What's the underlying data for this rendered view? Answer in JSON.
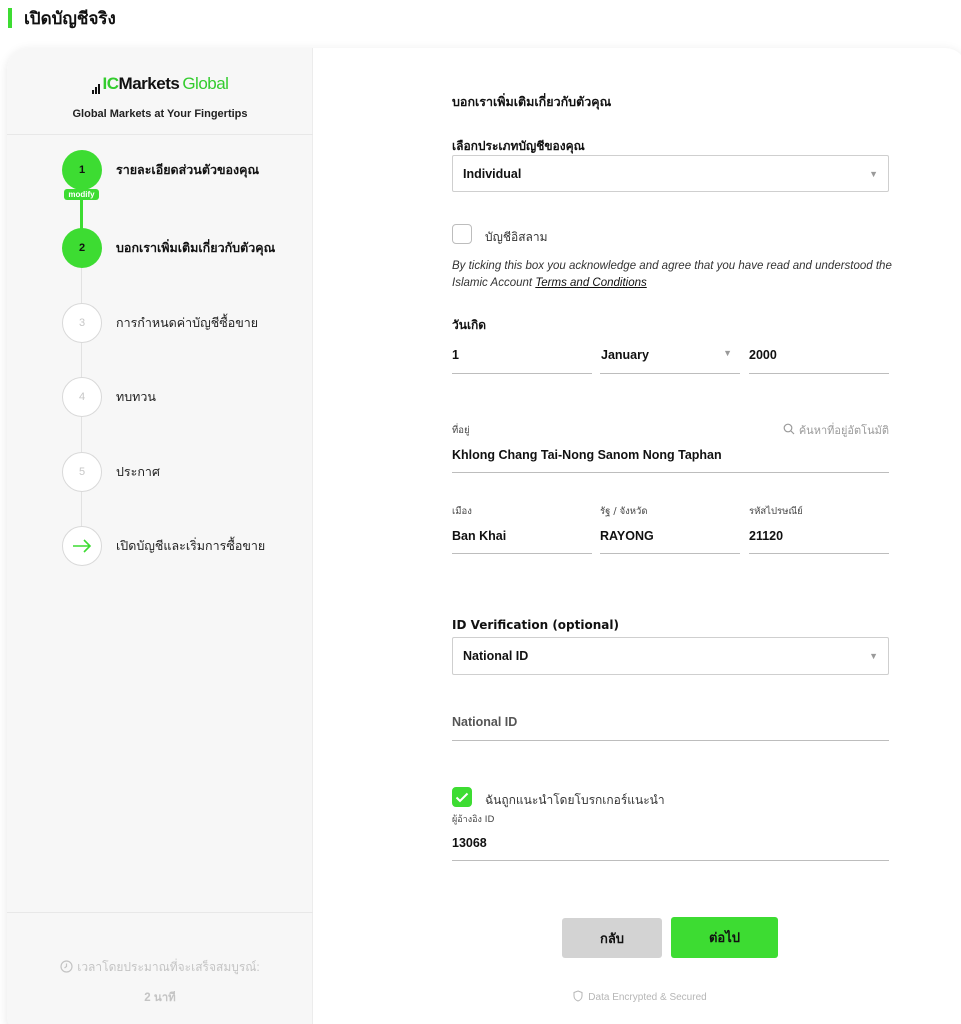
{
  "page": {
    "title": "เปิดบัญชีจริง"
  },
  "brand": {
    "logo_ic": "IC",
    "logo_markets": "Markets",
    "logo_global": "Global",
    "tagline": "Global Markets at Your Fingertips"
  },
  "steps": [
    {
      "number": "1",
      "label": "รายละเอียดส่วนตัวของคุณ",
      "state": "done",
      "badge": "modify"
    },
    {
      "number": "2",
      "label": "บอกเราเพิ่มเติมเกี่ยวกับตัวคุณ",
      "state": "active"
    },
    {
      "number": "3",
      "label": "การกำหนดค่าบัญชีซื้อขาย",
      "state": "pending"
    },
    {
      "number": "4",
      "label": "ทบทวน",
      "state": "pending"
    },
    {
      "number": "5",
      "label": "ประกาศ",
      "state": "pending"
    },
    {
      "number": "",
      "label": "เปิดบัญชีและเริ่มการซื้อขาย",
      "state": "final",
      "icon": "arrow-right-icon"
    }
  ],
  "sidebar_footer": {
    "time_label": "เวลาโดยประมาณที่จะเสร็จสมบูรณ์:",
    "time_value": "2 นาที"
  },
  "form": {
    "section_title": "บอกเราเพิ่มเติมเกี่ยวกับตัวคุณ",
    "account_type": {
      "label": "เลือกประเภทบัญชีของคุณ",
      "value": "Individual"
    },
    "islamic": {
      "label": "บัญชีอิสลาม",
      "checked": false,
      "note": "By ticking this box you acknowledge and agree that you have read and understood the Islamic Account",
      "terms_link": "Terms and Conditions"
    },
    "dob": {
      "label": "วันเกิด",
      "day": "1",
      "month": "January",
      "year": "2000"
    },
    "address": {
      "label": "ที่อยู่",
      "value": "Khlong Chang Tai-Nong Sanom Nong Taphan",
      "autosearch": "ค้นหาที่อยู่อัตโนมัติ"
    },
    "city": {
      "label": "เมือง",
      "value": "Ban Khai"
    },
    "state": {
      "label": "รัฐ / จังหวัด",
      "value": "RAYONG"
    },
    "postcode": {
      "label": "รหัสไปรษณีย์",
      "value": "21120"
    },
    "id_verification": {
      "label": "ID Verification (optional)",
      "value": "National ID"
    },
    "national_id": {
      "placeholder": "National ID"
    },
    "referral": {
      "checkbox_label": "ฉันถูกแนะนำโดยโบรกเกอร์แนะนำ",
      "checked": true,
      "id_label": "ผู้อ้างอิง ID",
      "id_value": "13068"
    },
    "buttons": {
      "back": "กลับ",
      "next": "ต่อไป"
    },
    "secure_note": "Data Encrypted & Secured"
  },
  "colors": {
    "accent": "#3ddc32",
    "sidebar_bg": "#f7f7f7"
  }
}
